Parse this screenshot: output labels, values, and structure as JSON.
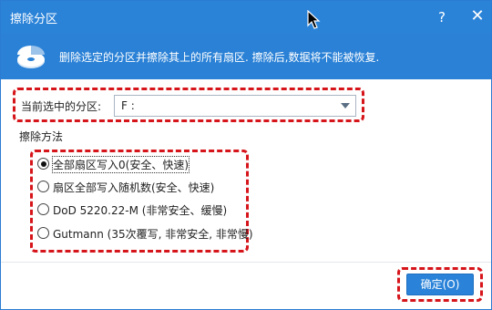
{
  "window": {
    "title": "擦除分区",
    "help_label": "?",
    "close_label": "✕"
  },
  "info": {
    "text": "删除选定的分区并擦除其上的所有扇区. 擦除后,数据将不能被恢复."
  },
  "partition": {
    "label": "当前选中的分区:",
    "selected": "F :"
  },
  "wipe_method": {
    "title": "擦除方法",
    "options": [
      {
        "label": "全部扇区写入0(安全、快速)",
        "checked": true
      },
      {
        "label": "扇区全部写入随机数(安全、快速)",
        "checked": false
      },
      {
        "label": "DoD 5220.22-M (非常安全、缓慢)",
        "checked": false
      },
      {
        "label": "Gutmann (35次覆写, 非常安全, 非常慢)",
        "checked": false
      }
    ]
  },
  "footer": {
    "ok_label": "确定(O)"
  },
  "colors": {
    "titlebar": "#2b83d8",
    "infobar": "#2a81d6",
    "highlight_dashes": "#d6151b",
    "button": "#2a83d9"
  }
}
